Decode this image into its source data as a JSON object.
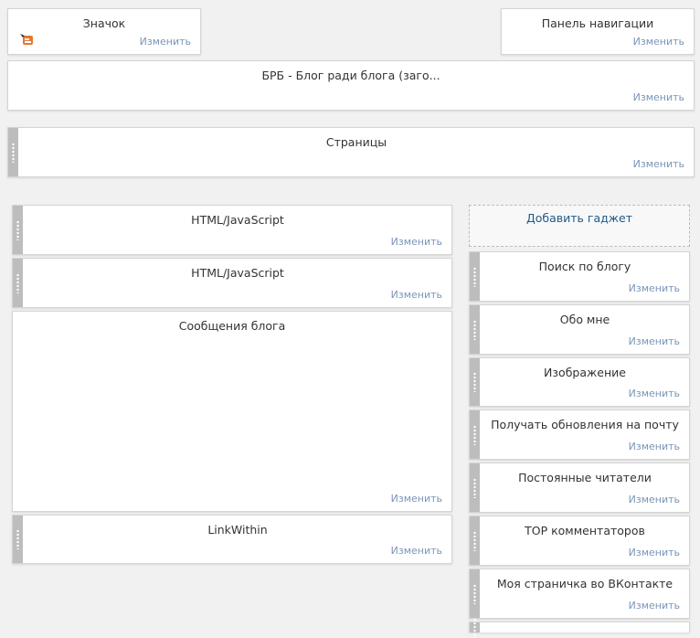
{
  "header_gadgets": {
    "favicon": {
      "title": "Значок",
      "edit": "Изменить",
      "icon": "blogger-orange-icon"
    },
    "navbar": {
      "title": "Панель навигации",
      "edit": "Изменить"
    },
    "blog_header": {
      "title": "БРБ - Блог ради блога (заго...",
      "edit": "Изменить"
    },
    "pages": {
      "title": "Страницы",
      "edit": "Изменить"
    }
  },
  "main_column": [
    {
      "title": "HTML/JavaScript",
      "edit": "Изменить"
    },
    {
      "title": "HTML/JavaScript",
      "edit": "Изменить"
    },
    {
      "title": "Сообщения блога",
      "edit": "Изменить"
    },
    {
      "title": "LinkWithin",
      "edit": "Изменить"
    }
  ],
  "sidebar": {
    "add_gadget": "Добавить гаджет",
    "gadgets": [
      {
        "title": "Поиск по блогу",
        "edit": "Изменить"
      },
      {
        "title": "Обо мне",
        "edit": "Изменить"
      },
      {
        "title": "Изображение",
        "edit": "Изменить"
      },
      {
        "title": "Получать обновления на почту",
        "edit": "Изменить"
      },
      {
        "title": "Постоянные читатели",
        "edit": "Изменить"
      },
      {
        "title": "TOP комментаторов",
        "edit": "Изменить"
      },
      {
        "title": "Моя страничка во ВКонтакте",
        "edit": "Изменить"
      }
    ]
  },
  "colors": {
    "link": "#7a95b8",
    "add_gadget": "#1f5a8a",
    "handle": "#bdbdbd"
  }
}
